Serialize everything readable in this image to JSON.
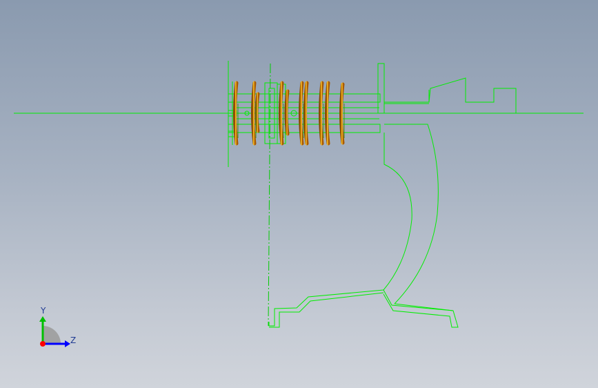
{
  "viewport": {
    "background_top": "#8a9aaf",
    "background_bottom": "#d0d4db",
    "edge_color": "#00ff00",
    "spring_color": "#ff9d00"
  },
  "triad": {
    "y_label": "Y",
    "z_label": "Z",
    "y_color": "#00c000",
    "z_color": "#0000ff",
    "x_color": "#ff0000"
  }
}
